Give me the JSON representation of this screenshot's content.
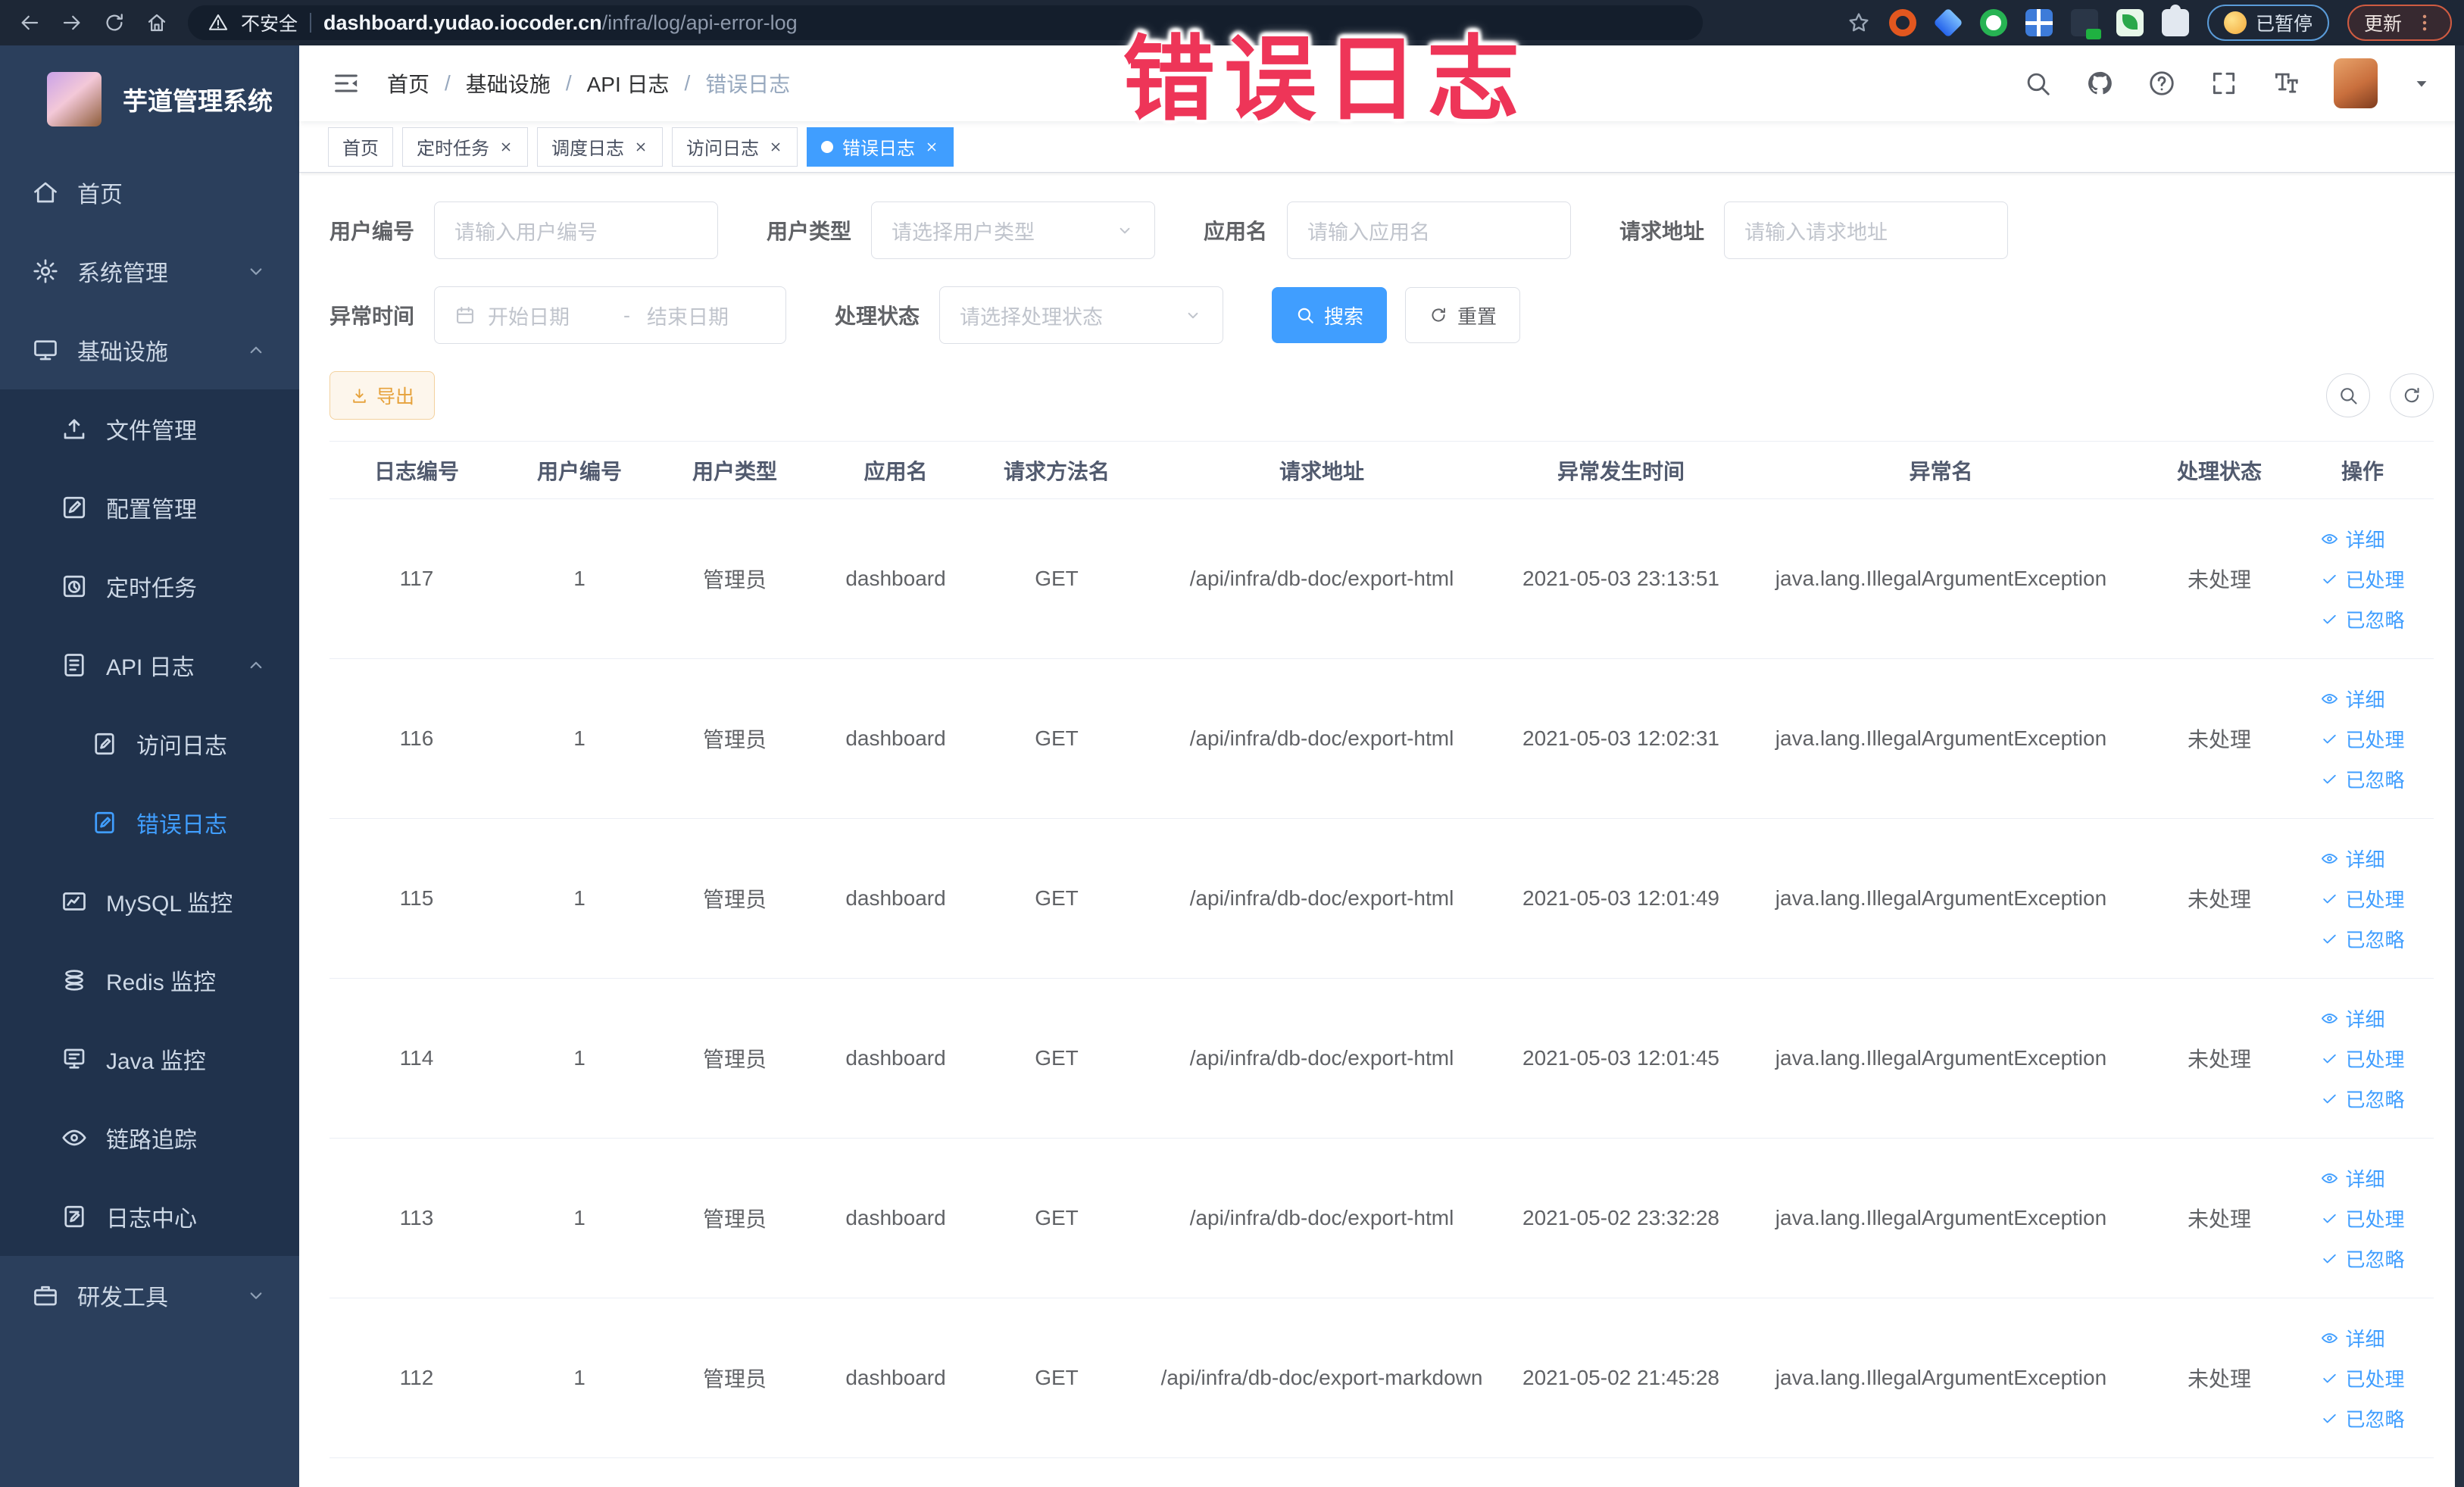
{
  "browser": {
    "security_label": "不安全",
    "url_host": "dashboard.yudao.iocoder.cn",
    "url_path": "/infra/log/api-error-log",
    "paused_label": "已暂停",
    "update_label": "更新"
  },
  "annotation": {
    "text": "错误日志",
    "color": "#ee3558"
  },
  "colors": {
    "accent": "#409eff",
    "export_text": "#e6a23c",
    "sidebar_bg": "#2b3f5c",
    "submenu_bg": "#20324c"
  },
  "sidebar": {
    "title": "芋道管理系统",
    "items": [
      {
        "label": "首页",
        "icon": "home",
        "level": 0
      },
      {
        "label": "系统管理",
        "icon": "gear",
        "level": 0,
        "arrow": "down"
      },
      {
        "label": "基础设施",
        "icon": "infra",
        "level": 0,
        "arrow": "up"
      },
      {
        "label": "文件管理",
        "icon": "upload",
        "level": 1
      },
      {
        "label": "配置管理",
        "icon": "edit",
        "level": 1
      },
      {
        "label": "定时任务",
        "icon": "timer",
        "level": 1
      },
      {
        "label": "API 日志",
        "icon": "apilog",
        "level": 1,
        "arrow": "up"
      },
      {
        "label": "访问日志",
        "icon": "sublog",
        "level": 2
      },
      {
        "label": "错误日志",
        "icon": "sublog",
        "level": 2,
        "active": true
      },
      {
        "label": "MySQL 监控",
        "icon": "mysql",
        "level": 1
      },
      {
        "label": "Redis 监控",
        "icon": "redis",
        "level": 1
      },
      {
        "label": "Java 监控",
        "icon": "java",
        "level": 1
      },
      {
        "label": "链路追踪",
        "icon": "trace",
        "level": 1
      },
      {
        "label": "日志中心",
        "icon": "logcenter",
        "level": 1
      },
      {
        "label": "研发工具",
        "icon": "tools",
        "level": 0,
        "arrow": "down"
      }
    ]
  },
  "header": {
    "breadcrumb": {
      "items": [
        "首页",
        "基础设施",
        "API 日志"
      ],
      "separator": "/",
      "current": "错误日志"
    },
    "icons": [
      "search",
      "github",
      "help",
      "fullscreen",
      "fontsize"
    ]
  },
  "tabs": [
    {
      "label": "首页",
      "closable": false,
      "active": false
    },
    {
      "label": "定时任务",
      "closable": true,
      "active": false
    },
    {
      "label": "调度日志",
      "closable": true,
      "active": false
    },
    {
      "label": "访问日志",
      "closable": true,
      "active": false
    },
    {
      "label": "错误日志",
      "closable": true,
      "active": true
    }
  ],
  "filters": {
    "user_id": {
      "label": "用户编号",
      "placeholder": "请输入用户编号"
    },
    "user_type": {
      "label": "用户类型",
      "placeholder": "请选择用户类型"
    },
    "app_name": {
      "label": "应用名",
      "placeholder": "请输入应用名"
    },
    "request_url": {
      "label": "请求地址",
      "placeholder": "请输入请求地址"
    },
    "exception_time": {
      "label": "异常时间",
      "start_placeholder": "开始日期",
      "separator": "-",
      "end_placeholder": "结束日期"
    },
    "process_status": {
      "label": "处理状态",
      "placeholder": "请选择处理状态"
    },
    "search_button": "搜索",
    "reset_button": "重置"
  },
  "toolbar": {
    "export_button": "导出"
  },
  "table": {
    "columns": [
      "日志编号",
      "用户编号",
      "用户类型",
      "应用名",
      "请求方法名",
      "请求地址",
      "异常发生时间",
      "异常名",
      "处理状态",
      "操作"
    ],
    "action_labels": [
      "详细",
      "已处理",
      "已忽略"
    ],
    "rows": [
      {
        "id": "117",
        "user": "1",
        "type": "管理员",
        "app": "dashboard",
        "method": "GET",
        "url": "/api/infra/db-doc/export-html",
        "time": "2021-05-03 23:13:51",
        "exception": "java.lang.IllegalArgumentException",
        "status": "未处理"
      },
      {
        "id": "116",
        "user": "1",
        "type": "管理员",
        "app": "dashboard",
        "method": "GET",
        "url": "/api/infra/db-doc/export-html",
        "time": "2021-05-03 12:02:31",
        "exception": "java.lang.IllegalArgumentException",
        "status": "未处理"
      },
      {
        "id": "115",
        "user": "1",
        "type": "管理员",
        "app": "dashboard",
        "method": "GET",
        "url": "/api/infra/db-doc/export-html",
        "time": "2021-05-03 12:01:49",
        "exception": "java.lang.IllegalArgumentException",
        "status": "未处理"
      },
      {
        "id": "114",
        "user": "1",
        "type": "管理员",
        "app": "dashboard",
        "method": "GET",
        "url": "/api/infra/db-doc/export-html",
        "time": "2021-05-03 12:01:45",
        "exception": "java.lang.IllegalArgumentException",
        "status": "未处理"
      },
      {
        "id": "113",
        "user": "1",
        "type": "管理员",
        "app": "dashboard",
        "method": "GET",
        "url": "/api/infra/db-doc/export-html",
        "time": "2021-05-02 23:32:28",
        "exception": "java.lang.IllegalArgumentException",
        "status": "未处理"
      },
      {
        "id": "112",
        "user": "1",
        "type": "管理员",
        "app": "dashboard",
        "method": "GET",
        "url": "/api/infra/db-doc/export-markdown",
        "time": "2021-05-02 21:45:28",
        "exception": "java.lang.IllegalArgumentException",
        "status": "未处理"
      }
    ]
  }
}
